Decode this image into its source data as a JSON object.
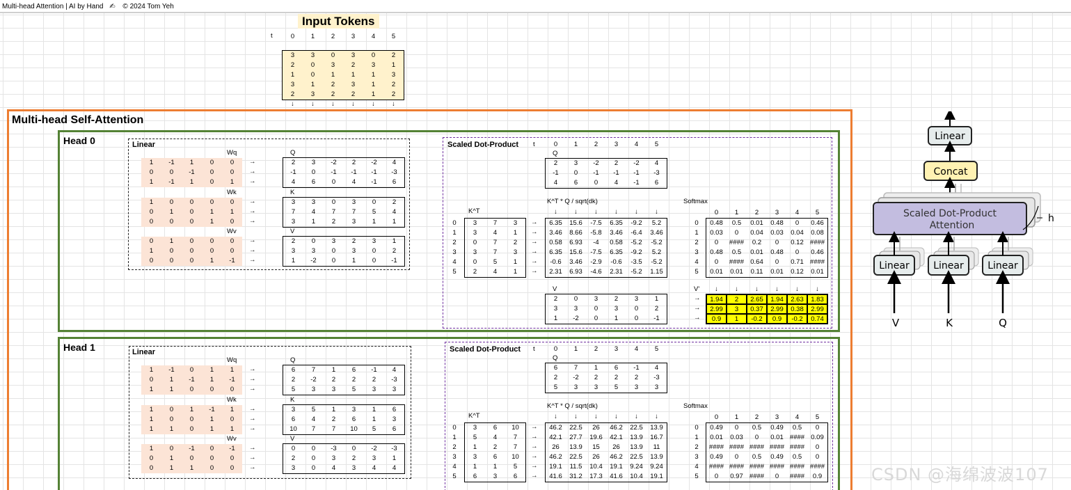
{
  "window": {
    "title": "Multi-head Attention | AI by Hand",
    "emoji": "✍",
    "copyright": "© 2024 Tom Yeh"
  },
  "input": {
    "title": "Input Tokens",
    "t_label": "t",
    "cols": [
      "0",
      "1",
      "2",
      "3",
      "4",
      "5"
    ],
    "matrix": [
      [
        "3",
        "3",
        "0",
        "3",
        "0",
        "2"
      ],
      [
        "2",
        "0",
        "3",
        "2",
        "3",
        "1"
      ],
      [
        "1",
        "0",
        "1",
        "1",
        "1",
        "3"
      ],
      [
        "3",
        "1",
        "2",
        "3",
        "1",
        "2"
      ],
      [
        "2",
        "3",
        "2",
        "2",
        "1",
        "2"
      ]
    ],
    "arrows": [
      "↓",
      "↓",
      "↓",
      "↓",
      "↓",
      "↓"
    ]
  },
  "section_title": "Multi-head Self-Attention",
  "heads": [
    {
      "title": "Head 0",
      "linear": {
        "title": "Linear",
        "wq_label": "Wq",
        "wq": [
          [
            "1",
            "-1",
            "1",
            "0",
            "0"
          ],
          [
            "0",
            "0",
            "-1",
            "0",
            "0"
          ],
          [
            "1",
            "-1",
            "1",
            "0",
            "1"
          ]
        ],
        "wk_label": "Wk",
        "wk": [
          [
            "1",
            "0",
            "0",
            "0",
            "0"
          ],
          [
            "0",
            "1",
            "0",
            "1",
            "1"
          ],
          [
            "0",
            "0",
            "0",
            "1",
            "0"
          ]
        ],
        "wv_label": "Wv",
        "wv": [
          [
            "0",
            "1",
            "0",
            "0",
            "0"
          ],
          [
            "1",
            "0",
            "0",
            "0",
            "0"
          ],
          [
            "0",
            "0",
            "0",
            "1",
            "-1"
          ]
        ],
        "q_label": "Q",
        "q": [
          [
            "2",
            "3",
            "-2",
            "2",
            "-2",
            "4"
          ],
          [
            "-1",
            "0",
            "-1",
            "-1",
            "-1",
            "-3"
          ],
          [
            "4",
            "6",
            "0",
            "4",
            "-1",
            "6"
          ]
        ],
        "k_label": "K",
        "k": [
          [
            "3",
            "3",
            "0",
            "3",
            "0",
            "2"
          ],
          [
            "7",
            "4",
            "7",
            "7",
            "5",
            "4"
          ],
          [
            "3",
            "1",
            "2",
            "3",
            "1",
            "1"
          ]
        ],
        "v_label": "V",
        "v": [
          [
            "2",
            "0",
            "3",
            "2",
            "3",
            "1"
          ],
          [
            "3",
            "3",
            "0",
            "3",
            "0",
            "2"
          ],
          [
            "1",
            "-2",
            "0",
            "1",
            "0",
            "-1"
          ]
        ]
      },
      "sdp": {
        "title": "Scaled Dot-Product",
        "t_label": "t",
        "cols": [
          "0",
          "1",
          "2",
          "3",
          "4",
          "5"
        ],
        "q_label": "Q",
        "q": [
          [
            "2",
            "3",
            "-2",
            "2",
            "-2",
            "4"
          ],
          [
            "-1",
            "0",
            "-1",
            "-1",
            "-1",
            "-3"
          ],
          [
            "4",
            "6",
            "0",
            "4",
            "-1",
            "6"
          ]
        ],
        "kt_label": "K^T",
        "row_idx": [
          "0",
          "1",
          "2",
          "3",
          "4",
          "5"
        ],
        "kt": [
          [
            "3",
            "7",
            "3"
          ],
          [
            "3",
            "4",
            "1"
          ],
          [
            "0",
            "7",
            "2"
          ],
          [
            "3",
            "7",
            "3"
          ],
          [
            "0",
            "5",
            "1"
          ],
          [
            "2",
            "4",
            "1"
          ]
        ],
        "scores_label": "K^T * Q / sqrt(dk)",
        "scores": [
          [
            "6.35",
            "15.6",
            "-7.5",
            "6.35",
            "-9.2",
            "5.2"
          ],
          [
            "3.46",
            "8.66",
            "-5.8",
            "3.46",
            "-6.4",
            "3.46"
          ],
          [
            "0.58",
            "6.93",
            "-4",
            "0.58",
            "-5.2",
            "-5.2"
          ],
          [
            "6.35",
            "15.6",
            "-7.5",
            "6.35",
            "-9.2",
            "5.2"
          ],
          [
            "-0.6",
            "3.46",
            "-2.9",
            "-0.6",
            "-3.5",
            "-5.2"
          ],
          [
            "2.31",
            "6.93",
            "-4.6",
            "2.31",
            "-5.2",
            "1.15"
          ]
        ],
        "softmax_label": "Softmax",
        "softmax": [
          [
            "0.48",
            "0.5",
            "0.01",
            "0.48",
            "0",
            "0.46"
          ],
          [
            "0.03",
            "0",
            "0.04",
            "0.03",
            "0.04",
            "0.08"
          ],
          [
            "0",
            "####",
            "0.2",
            "0",
            "0.12",
            "####"
          ],
          [
            "0.48",
            "0.5",
            "0.01",
            "0.48",
            "0",
            "0.46"
          ],
          [
            "0",
            "####",
            "0.64",
            "0",
            "0.71",
            "####"
          ],
          [
            "0.01",
            "0.01",
            "0.11",
            "0.01",
            "0.12",
            "0.01"
          ]
        ],
        "v_label": "V",
        "v": [
          [
            "2",
            "0",
            "3",
            "2",
            "3",
            "1"
          ],
          [
            "3",
            "3",
            "0",
            "3",
            "0",
            "2"
          ],
          [
            "1",
            "-2",
            "0",
            "1",
            "0",
            "-1"
          ]
        ],
        "vp_label": "V'",
        "vp": [
          [
            "1.94",
            "2",
            "2.65",
            "1.94",
            "2.63",
            "1.83"
          ],
          [
            "2.99",
            "3",
            "0.37",
            "2.99",
            "0.38",
            "2.99"
          ],
          [
            "0.9",
            "1",
            "-0.2",
            "0.9",
            "-0.2",
            "0.74"
          ]
        ]
      }
    },
    {
      "title": "Head 1",
      "linear": {
        "title": "Linear",
        "wq_label": "Wq",
        "wq": [
          [
            "1",
            "-1",
            "0",
            "1",
            "1"
          ],
          [
            "0",
            "1",
            "-1",
            "1",
            "-1"
          ],
          [
            "1",
            "1",
            "0",
            "0",
            "0"
          ]
        ],
        "wk_label": "Wk",
        "wk": [
          [
            "1",
            "0",
            "1",
            "-1",
            "1"
          ],
          [
            "1",
            "0",
            "0",
            "1",
            "0"
          ],
          [
            "1",
            "1",
            "0",
            "1",
            "1"
          ]
        ],
        "wv_label": "Wv",
        "wv": [
          [
            "1",
            "0",
            "-1",
            "0",
            "-1"
          ],
          [
            "0",
            "1",
            "0",
            "0",
            "0"
          ],
          [
            "0",
            "1",
            "1",
            "0",
            "0"
          ]
        ],
        "q_label": "Q",
        "q": [
          [
            "6",
            "7",
            "1",
            "6",
            "-1",
            "4"
          ],
          [
            "2",
            "-2",
            "2",
            "2",
            "2",
            "-3"
          ],
          [
            "5",
            "3",
            "3",
            "5",
            "3",
            "3"
          ]
        ],
        "k_label": "K",
        "k": [
          [
            "3",
            "5",
            "1",
            "3",
            "1",
            "6"
          ],
          [
            "6",
            "4",
            "2",
            "6",
            "1",
            "3"
          ],
          [
            "10",
            "7",
            "7",
            "10",
            "5",
            "6"
          ]
        ],
        "v_label": "V",
        "v": [
          [
            "0",
            "0",
            "-3",
            "0",
            "-2",
            "-3"
          ],
          [
            "2",
            "0",
            "3",
            "2",
            "3",
            "1"
          ],
          [
            "3",
            "0",
            "4",
            "3",
            "4",
            "4"
          ]
        ]
      },
      "sdp": {
        "title": "Scaled Dot-Product",
        "t_label": "t",
        "cols": [
          "0",
          "1",
          "2",
          "3",
          "4",
          "5"
        ],
        "q_label": "Q",
        "q": [
          [
            "6",
            "7",
            "1",
            "6",
            "-1",
            "4"
          ],
          [
            "2",
            "-2",
            "2",
            "2",
            "2",
            "-3"
          ],
          [
            "5",
            "3",
            "3",
            "5",
            "3",
            "3"
          ]
        ],
        "kt_label": "K^T",
        "row_idx": [
          "0",
          "1",
          "2",
          "3",
          "4",
          "5"
        ],
        "kt": [
          [
            "3",
            "6",
            "10"
          ],
          [
            "5",
            "4",
            "7"
          ],
          [
            "1",
            "2",
            "7"
          ],
          [
            "3",
            "6",
            "10"
          ],
          [
            "1",
            "1",
            "5"
          ],
          [
            "6",
            "3",
            "6"
          ]
        ],
        "scores_label": "K^T * Q / sqrt(dk)",
        "scores": [
          [
            "46.2",
            "22.5",
            "26",
            "46.2",
            "22.5",
            "13.9"
          ],
          [
            "42.1",
            "27.7",
            "19.6",
            "42.1",
            "13.9",
            "16.7"
          ],
          [
            "26",
            "13.9",
            "15",
            "26",
            "13.9",
            "11"
          ],
          [
            "46.2",
            "22.5",
            "26",
            "46.2",
            "22.5",
            "13.9"
          ],
          [
            "19.1",
            "11.5",
            "10.4",
            "19.1",
            "9.24",
            "9.24"
          ],
          [
            "41.6",
            "31.2",
            "17.3",
            "41.6",
            "10.4",
            "19.1"
          ]
        ],
        "softmax_label": "Softmax",
        "softmax": [
          [
            "0.49",
            "0",
            "0.5",
            "0.49",
            "0.5",
            "0"
          ],
          [
            "0.01",
            "0.03",
            "0",
            "0.01",
            "####",
            "0.09"
          ],
          [
            "####",
            "####",
            "####",
            "####",
            "####",
            "0"
          ],
          [
            "0.49",
            "0",
            "0.5",
            "0.49",
            "0.5",
            "0"
          ],
          [
            "####",
            "####",
            "####",
            "####",
            "####",
            "####"
          ],
          [
            "0",
            "0.97",
            "####",
            "0",
            "####",
            "0.9"
          ]
        ]
      }
    }
  ],
  "diagram": {
    "linear_top": "Linear",
    "concat": "Concat",
    "sdpa": "Scaled Dot-Product Attention",
    "h": "h",
    "linear_v": "Linear",
    "linear_k": "Linear",
    "linear_q": "Linear",
    "v": "V",
    "k": "K",
    "q": "Q"
  },
  "watermark": "CSDN @海绵波波107",
  "colors": {
    "orange": "#ed7d31",
    "green": "#548235",
    "peach": "#fce4d6",
    "yellow": "#ffff00",
    "cream": "#fff2cc",
    "purple": "#7030a0",
    "concat": "#fff2b3",
    "attention": "#c3bde0",
    "linear_fill": "#e6ecec"
  }
}
